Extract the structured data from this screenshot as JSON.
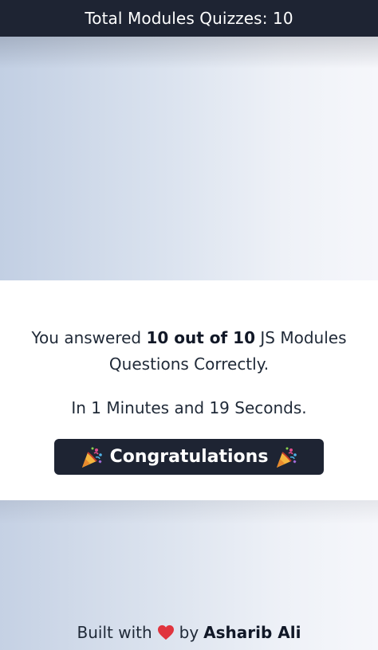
{
  "header": {
    "title": "Total Modules Quizzes: 10"
  },
  "result": {
    "prefix": "You answered",
    "score": "10 out of 10",
    "suffix": "JS Modules Questions Correctly.",
    "time_text": "In 1 Minutes and 19 Seconds.",
    "congrats_label": "Congratulations"
  },
  "footer": {
    "built_with": "Built with",
    "by": "by",
    "author": "Asharib Ali"
  },
  "icons": {
    "party": "party-popper-icon",
    "heart": "heart-icon"
  },
  "colors": {
    "header_bg": "#1e2433",
    "button_bg": "#1e2433",
    "heart": "#e0343e"
  }
}
